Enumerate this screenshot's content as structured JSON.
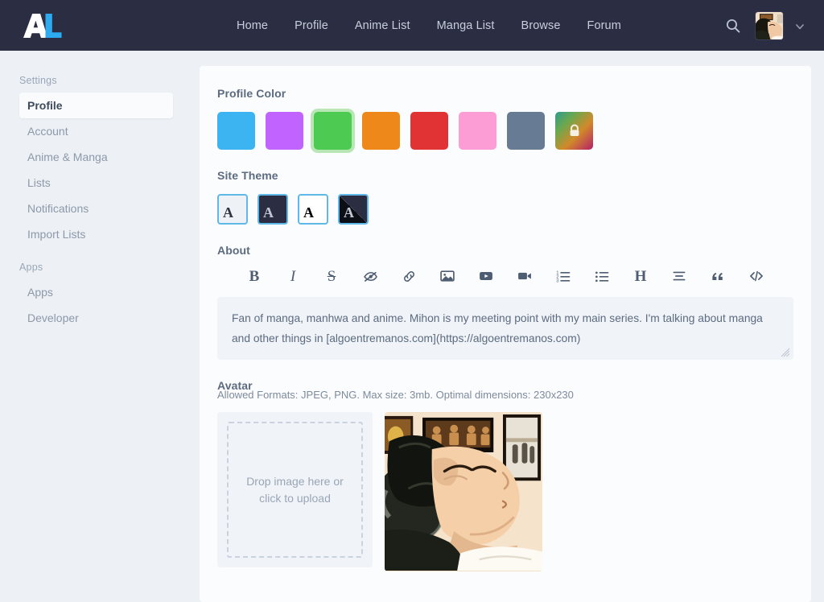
{
  "navbar": {
    "logo_alt": "AniList",
    "links": [
      {
        "label": "Home"
      },
      {
        "label": "Profile"
      },
      {
        "label": "Anime List"
      },
      {
        "label": "Manga List"
      },
      {
        "label": "Browse"
      },
      {
        "label": "Forum"
      }
    ],
    "search_icon": "search-icon",
    "avatar_icon": "user-avatar",
    "dropdown_icon": "chevron-down-icon",
    "background_color": "#2b2d42",
    "link_color": "#c6cedb"
  },
  "sidebar": {
    "groups": [
      {
        "title": "Settings",
        "items": [
          {
            "label": "Profile",
            "active": true
          },
          {
            "label": "Account",
            "active": false
          },
          {
            "label": "Anime & Manga",
            "active": false
          },
          {
            "label": "Lists",
            "active": false
          },
          {
            "label": "Notifications",
            "active": false
          },
          {
            "label": "Import Lists",
            "active": false
          }
        ]
      },
      {
        "title": "Apps",
        "items": [
          {
            "label": "Apps",
            "active": false
          },
          {
            "label": "Developer",
            "active": false
          }
        ]
      }
    ]
  },
  "profile_color": {
    "label": "Profile Color",
    "selected_index": 2,
    "swatches": [
      {
        "name": "blue",
        "color": "#3db4f2",
        "locked": false
      },
      {
        "name": "purple",
        "color": "#c063ff",
        "locked": false
      },
      {
        "name": "green",
        "color": "#4cca51",
        "locked": false
      },
      {
        "name": "orange",
        "color": "#ef881a",
        "locked": false
      },
      {
        "name": "red",
        "color": "#e13333",
        "locked": false
      },
      {
        "name": "pink",
        "color": "#fc9dd6",
        "locked": false
      },
      {
        "name": "gray",
        "color": "#677b94",
        "locked": false
      },
      {
        "name": "custom",
        "color": "linear-gradient(135deg,#2d9b8f 0%,#6aa84f 28%,#d18a2a 60%,#b51f6a 100%)",
        "locked": true,
        "lock_icon": "lock-icon"
      }
    ]
  },
  "site_theme": {
    "label": "Site Theme",
    "options": [
      {
        "name": "light",
        "letter": "A"
      },
      {
        "name": "dark",
        "letter": "A"
      },
      {
        "name": "contrast",
        "letter": "A"
      },
      {
        "name": "auto",
        "letter": "A"
      }
    ]
  },
  "about": {
    "label": "About",
    "toolbar": [
      {
        "name": "bold-icon",
        "glyph": "B",
        "style": "serif"
      },
      {
        "name": "italic-icon",
        "glyph": "I",
        "style": "serif-i"
      },
      {
        "name": "strikethrough-icon",
        "glyph": "S",
        "style": "strike"
      },
      {
        "name": "spoiler-eye-off-icon",
        "glyph": "",
        "style": "svg"
      },
      {
        "name": "link-icon",
        "glyph": "",
        "style": "svg"
      },
      {
        "name": "image-icon",
        "glyph": "",
        "style": "svg"
      },
      {
        "name": "youtube-icon",
        "glyph": "",
        "style": "svg"
      },
      {
        "name": "video-icon",
        "glyph": "",
        "style": "svg"
      },
      {
        "name": "ordered-list-icon",
        "glyph": "",
        "style": "svg"
      },
      {
        "name": "bullet-list-icon",
        "glyph": "",
        "style": "svg"
      },
      {
        "name": "heading-icon",
        "glyph": "H",
        "style": "serif"
      },
      {
        "name": "align-center-icon",
        "glyph": "",
        "style": "svg"
      },
      {
        "name": "quote-icon",
        "glyph": "”",
        "style": "svg"
      },
      {
        "name": "code-icon",
        "glyph": "",
        "style": "svg"
      }
    ],
    "text": "Fan of manga, manhwa and anime. Mihon is my meeting point with my main series. I'm talking about manga and other things in [algoentremanos.com](https://algoentremanos.com)",
    "placeholder": "About"
  },
  "avatar": {
    "label": "Avatar",
    "hint": "Allowed Formats: JPEG, PNG. Max size: 3mb. Optimal dimensions: 230x230",
    "dropzone_text": "Drop image here or click to upload",
    "preview_alt": "sleeping anime character avatar"
  }
}
